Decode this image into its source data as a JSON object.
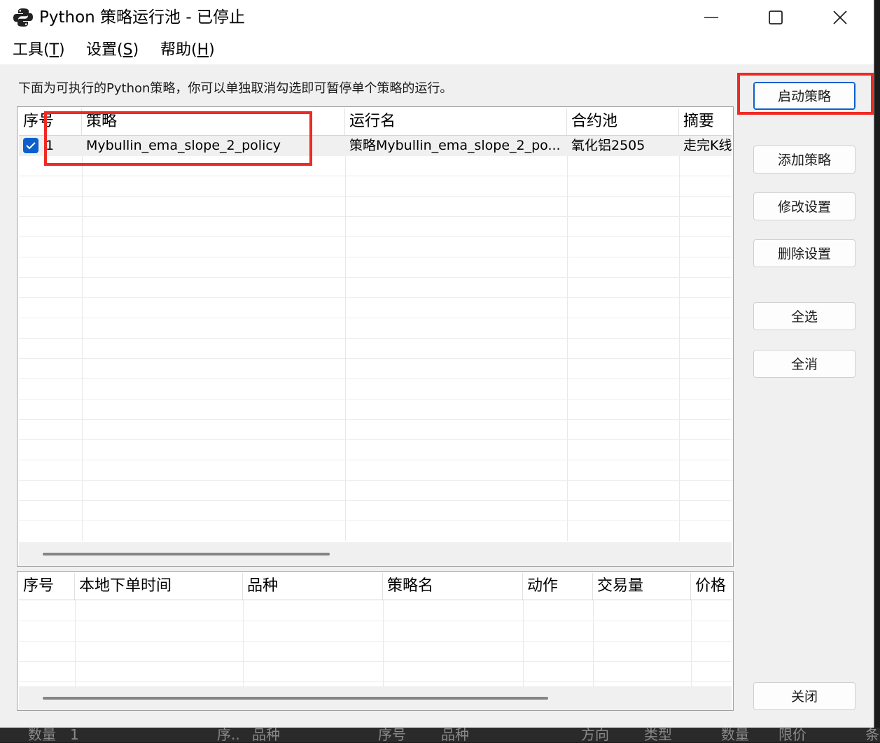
{
  "window": {
    "title": "Python 策略运行池 - 已停止",
    "icon": "python-icon"
  },
  "menu": [
    {
      "label": "工具(",
      "key": "T",
      "end": ")"
    },
    {
      "label": "设置(",
      "key": "S",
      "end": ")"
    },
    {
      "label": "帮助(",
      "key": "H",
      "end": ")"
    }
  ],
  "description": "下面为可执行的Python策略，你可以单独取消勾选即可暂停单个策略的运行。",
  "strategy_table": {
    "columns": [
      "序号",
      "策略",
      "运行名",
      "合约池",
      "摘要"
    ],
    "rows": [
      {
        "checked": true,
        "index": "1",
        "strategy": "Mybullin_ema_slope_2_policy",
        "run_name": "策略Mybullin_ema_slope_2_po...",
        "contract_pool": "氧化铝2505",
        "summary": "走完K线"
      }
    ]
  },
  "order_table": {
    "columns": [
      "序号",
      "本地下单时间",
      "品种",
      "策略名",
      "动作",
      "交易量",
      "价格"
    ]
  },
  "buttons": {
    "start": "启动策略",
    "add": "添加策略",
    "modify": "修改设置",
    "delete": "删除设置",
    "select_all": "全选",
    "deselect_all": "全消",
    "close": "关闭"
  },
  "background": {
    "texts": [
      "数量",
      "1",
      "序..",
      "品种",
      "序号",
      "品种",
      "方向",
      "类型",
      "数量",
      "限价",
      "条"
    ]
  },
  "colors": {
    "accent": "#0a5fcc",
    "annotation": "#ee2a24"
  }
}
